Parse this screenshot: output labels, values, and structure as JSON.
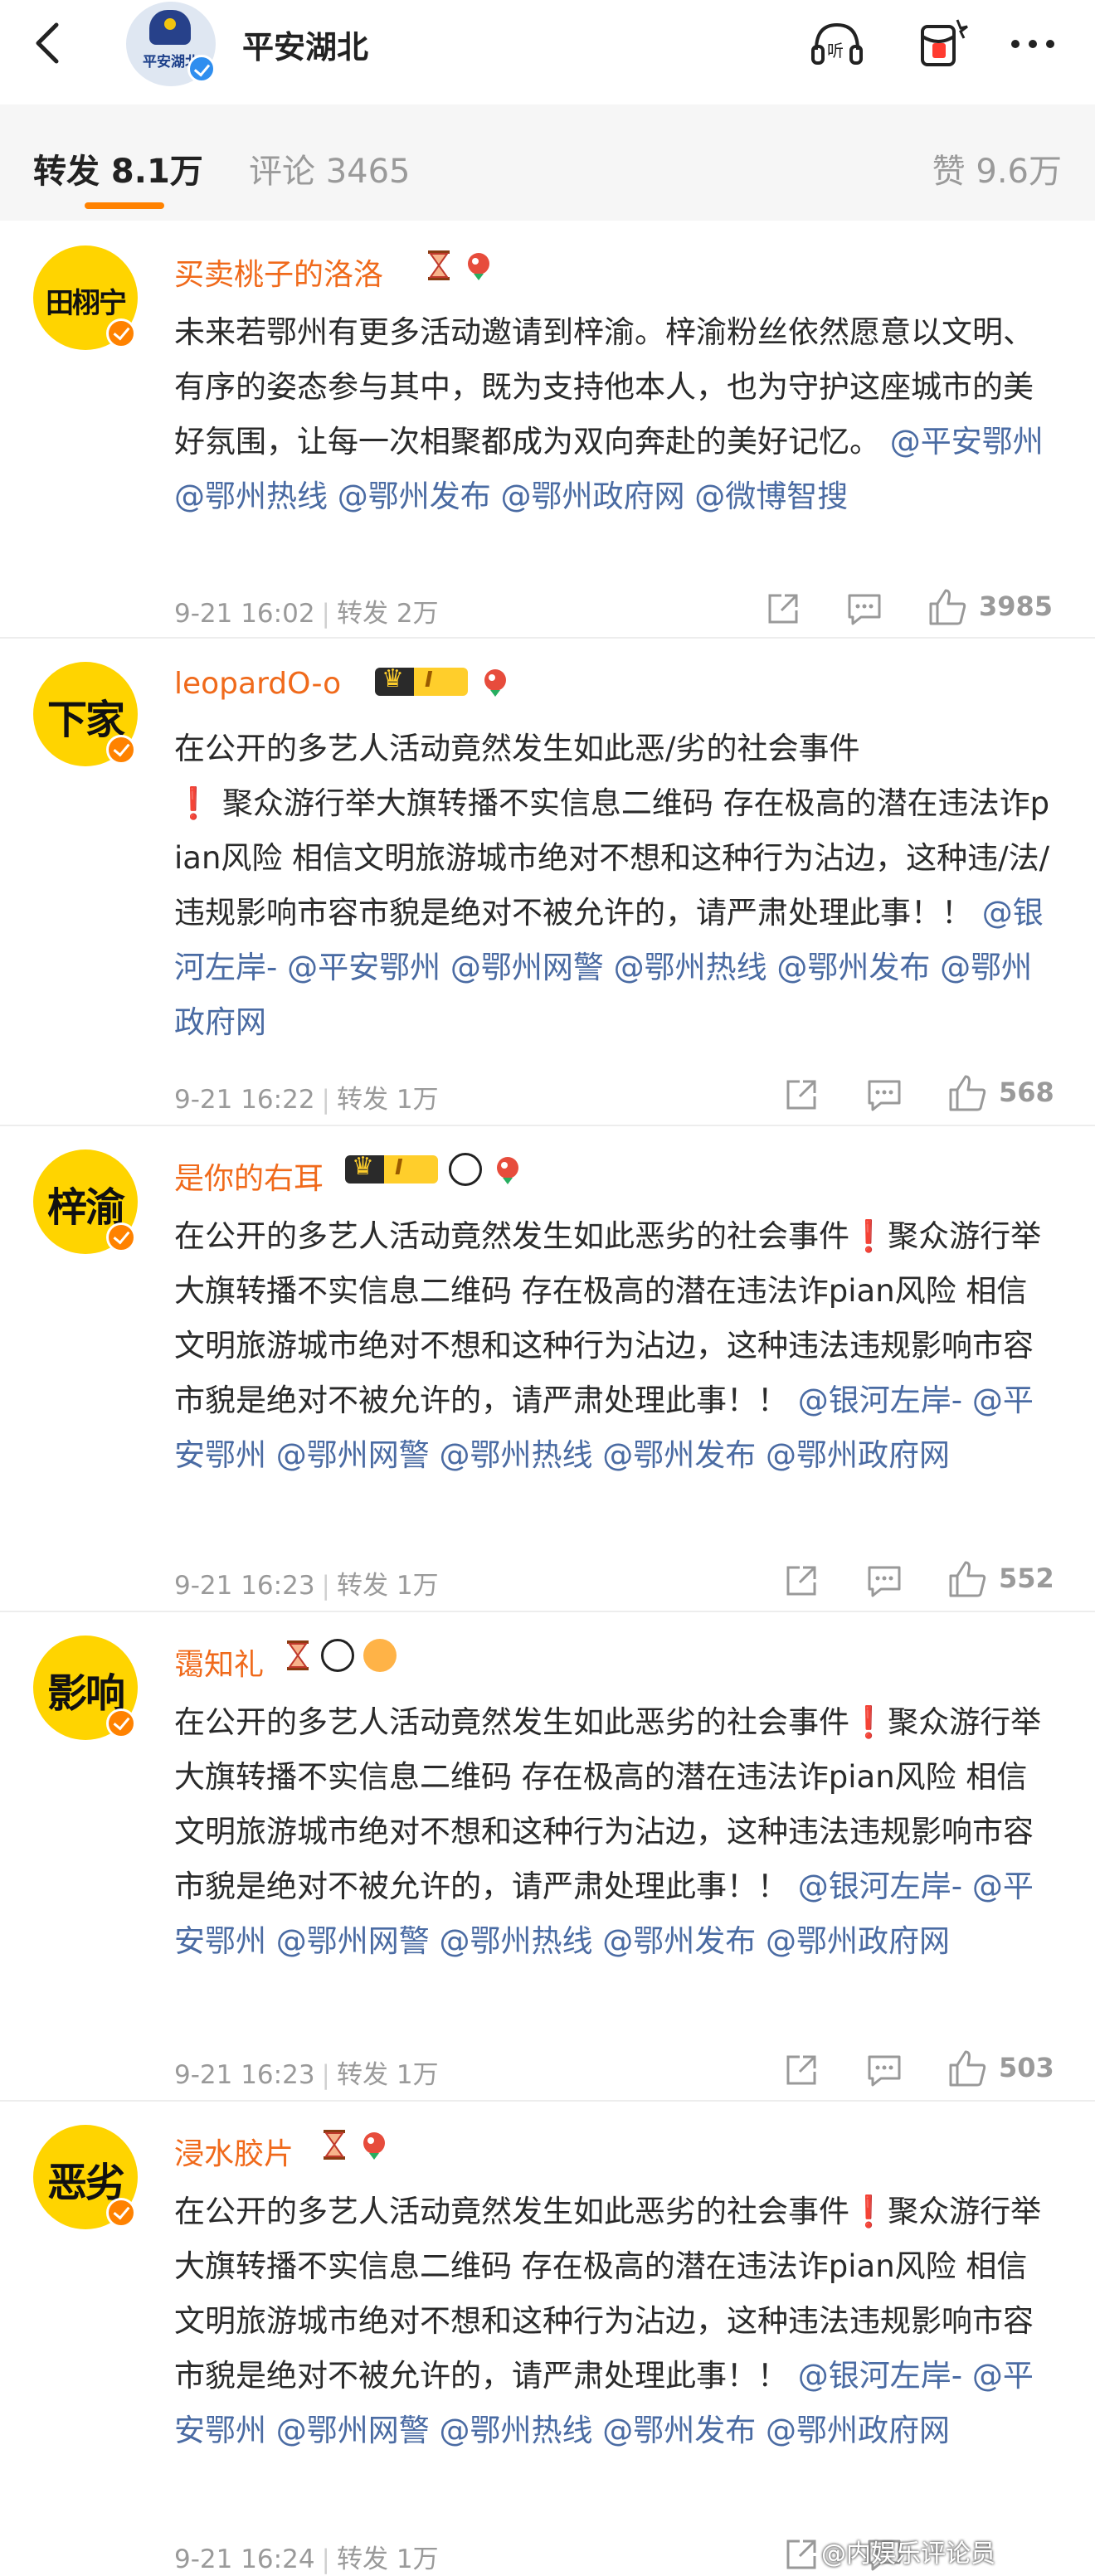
{
  "header": {
    "title": "平安湖北",
    "avatar_text": "平安湖北",
    "icons": [
      "back-icon",
      "listen-icon",
      "red-packet-icon",
      "more-icon"
    ]
  },
  "tabs": {
    "repost": "转发 8.1万",
    "comment": "评论 3465",
    "like": "赞 9.6万"
  },
  "posts": [
    {
      "avatar_text": "田栩宁",
      "username": "买卖桃子的洛洛",
      "text": "未来若鄂州有更多活动邀请到梓渝。梓渝粉丝依然愿意以文明、有序的姿态参与其中，既为支持他本人，也为守护这座城市的美好氛围，让每一次相聚都成为双向奔赴的美好记忆。",
      "mentions": " @平安鄂州 @鄂州热线 @鄂州发布 @鄂州政府网 @微博智搜",
      "time": "9-21 16:02",
      "repost": "转发 2万",
      "likes": "3985"
    },
    {
      "avatar_text": "下家",
      "username": "leopardO-o",
      "level": "I",
      "text_a": "在公开的多艺人活动竟然发生如此恶/劣的社会事件",
      "warn": "❗",
      "text_b": "聚众游行举大旗转播不实信息二维码 存在极高的潜在违法诈pian风险 相信文明旅游城市绝对不想和这种行为沾边，这种违/法/违规影响市容市貌是绝对不被允许的，请严肃处理此事！！",
      "mentions": " @银河左岸- @平安鄂州 @鄂州网警 @鄂州热线 @鄂州发布 @鄂州政府网",
      "time": "9-21 16:22",
      "repost": "转发 1万",
      "likes": "568"
    },
    {
      "avatar_text": "梓渝",
      "username": "是你的右耳",
      "level": "I",
      "text_a": "在公开的多艺人活动竟然发生如此恶劣的社会事件",
      "warn": "❗",
      "text_b": "聚众游行举大旗转播不实信息二维码 存在极高的潜在违法诈pian风险 相信文明旅游城市绝对不想和这种行为沾边，这种违法违规影响市容市貌是绝对不被允许的，请严肃处理此事！！",
      "mentions": " @银河左岸- @平安鄂州 @鄂州网警 @鄂州热线 @鄂州发布 @鄂州政府网",
      "time": "9-21 16:23",
      "repost": "转发 1万",
      "likes": "552"
    },
    {
      "avatar_text": "影响",
      "username": "霭知礼",
      "text_a": "在公开的多艺人活动竟然发生如此恶劣的社会事件",
      "warn": "❗",
      "text_b": "聚众游行举大旗转播不实信息二维码 存在极高的潜在违法诈pian风险 相信文明旅游城市绝对不想和这种行为沾边，这种违法违规影响市容市貌是绝对不被允许的，请严肃处理此事！！",
      "mentions": " @银河左岸- @平安鄂州 @鄂州网警 @鄂州热线 @鄂州发布 @鄂州政府网",
      "time": "9-21 16:23",
      "repost": "转发 1万",
      "likes": "503"
    },
    {
      "avatar_text": "恶劣",
      "username": "浸水胶片",
      "text_a": "在公开的多艺人活动竟然发生如此恶劣的社会事件",
      "warn": "❗",
      "text_b": "聚众游行举大旗转播不实信息二维码 存在极高的潜在违法诈pian风险 相信文明旅游城市绝对不想和这种行为沾边，这种违法违规影响市容市貌是绝对不被允许的，请严肃处理此事！！",
      "mentions": " @银河左岸- @平安鄂州 @鄂州网警 @鄂州热线 @鄂州发布 @鄂州政府网",
      "time": "9-21 16:24",
      "repost": "转发 1万",
      "likes": ""
    }
  ],
  "watermark": "@内娱乐评论员",
  "colors": {
    "accent": "#ff8200",
    "username": "#f06a1b",
    "mention": "#4a6ba3",
    "avatar_bg": "#ffd400",
    "warn": "#e60012"
  }
}
